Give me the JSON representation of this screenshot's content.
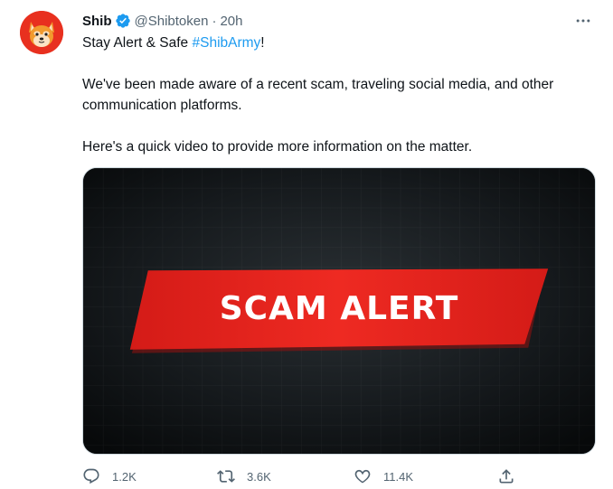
{
  "tweet": {
    "display_name": "Shib",
    "handle": "@Shibtoken",
    "separator": "·",
    "time": "20h",
    "line1_text": "Stay Alert & Safe ",
    "line1_hashtag": "#ShibArmy",
    "line1_end": "!",
    "paragraph2": "We've been made aware of a recent scam, traveling social media, and other communication platforms.",
    "paragraph3": "Here's a quick video to provide more information on the matter.",
    "media_text": "SCAM ALERT"
  },
  "actions": {
    "reply_count": "1.2K",
    "retweet_count": "3.6K",
    "like_count": "11.4K"
  },
  "icons": {
    "avatar": "shiba-inu-avatar",
    "verified": "verified-badge-icon",
    "more": "more-dots-icon",
    "reply": "reply-icon",
    "retweet": "retweet-icon",
    "like": "heart-icon",
    "share": "share-icon"
  },
  "colors": {
    "accent": "#1d9bf0",
    "muted": "#536471",
    "alert_red": "#e8231c",
    "avatar_bg": "#e8301f"
  }
}
